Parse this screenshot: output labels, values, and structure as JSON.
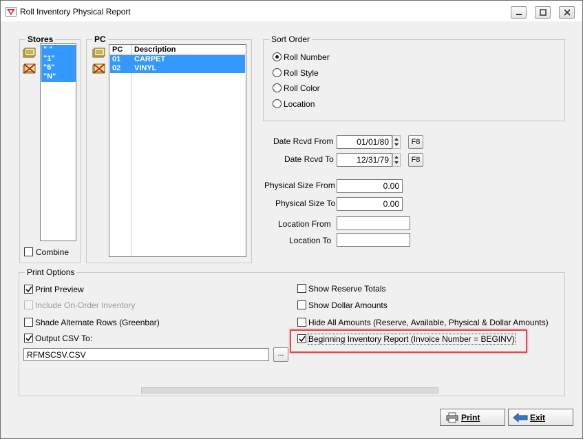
{
  "window": {
    "title": "Roll Inventory Physical Report"
  },
  "stores": {
    "label": "Stores",
    "items": [
      "\" \"",
      "\"1\"",
      "\"6\"",
      "\"N\""
    ],
    "combine_label": "Combine"
  },
  "pc": {
    "label": "PC",
    "col_pc": "PC",
    "col_desc": "Description",
    "rows": [
      {
        "code": "01",
        "desc": "CARPET"
      },
      {
        "code": "02",
        "desc": "VINYL"
      }
    ]
  },
  "sort_order": {
    "label": "Sort Order",
    "options": [
      "Roll Number",
      "Roll Style",
      "Roll Color",
      "Location"
    ],
    "selected": "Roll Number"
  },
  "filters": {
    "date_from_label": "Date Rcvd From",
    "date_from_value": "01/01/80",
    "date_to_label": "Date Rcvd To",
    "date_to_value": "12/31/79",
    "f8_label": "F8",
    "size_from_label": "Physical Size From",
    "size_from_value": "0.00",
    "size_to_label": "Physical Size To",
    "size_to_value": "0.00",
    "loc_from_label": "Location From",
    "loc_from_value": "",
    "loc_to_label": "Location To",
    "loc_to_value": ""
  },
  "print_options": {
    "label": "Print Options",
    "print_preview": "Print Preview",
    "include_on_order": "Include On-Order Inventory",
    "shade_rows": "Shade Alternate Rows (Greenbar)",
    "output_csv": "Output CSV To:",
    "csv_path": "RFMSCSV.CSV",
    "browse_label": "...",
    "show_reserve": "Show Reserve Totals",
    "show_dollar": "Show Dollar Amounts",
    "hide_all": "Hide All Amounts  (Reserve, Available, Physical & Dollar Amounts)",
    "beginning_inv": "Beginning Inventory Report  (Invoice Number = BEGINV)"
  },
  "buttons": {
    "print": "Print",
    "exit": "Exit"
  },
  "colors": {
    "selection": "#3399ff",
    "highlight": "#e0474c"
  }
}
